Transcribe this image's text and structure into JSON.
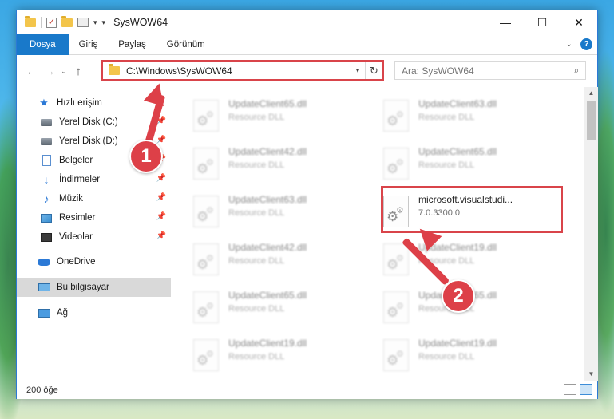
{
  "window": {
    "title": "SysWOW64",
    "controls": {
      "minimize": "—",
      "maximize": "☐",
      "close": "✕"
    }
  },
  "ribbon": {
    "tabs": [
      {
        "label": "Dosya",
        "active": true
      },
      {
        "label": "Giriş"
      },
      {
        "label": "Paylaş"
      },
      {
        "label": "Görünüm"
      }
    ],
    "help": "?"
  },
  "navigation": {
    "back": "←",
    "forward": "→",
    "recent": "⌄",
    "up": "↑",
    "address": "C:\\Windows\\SysWOW64",
    "search_placeholder": "Ara: SysWOW64"
  },
  "sidebar": {
    "items": [
      {
        "label": "Hızlı erişim",
        "icon": "star-icon"
      },
      {
        "label": "Yerel Disk (C:)",
        "icon": "drive-icon",
        "pinned": true
      },
      {
        "label": "Yerel Disk (D:)",
        "icon": "drive-icon",
        "pinned": true
      },
      {
        "label": "Belgeler",
        "icon": "documents-icon",
        "pinned": true
      },
      {
        "label": "İndirmeler",
        "icon": "downloads-icon",
        "pinned": true
      },
      {
        "label": "Müzik",
        "icon": "music-icon",
        "pinned": true
      },
      {
        "label": "Resimler",
        "icon": "pictures-icon",
        "pinned": true
      },
      {
        "label": "Videolar",
        "icon": "videos-icon",
        "pinned": true
      },
      {
        "label": "OneDrive",
        "icon": "onedrive-icon"
      },
      {
        "label": "Bu bilgisayar",
        "icon": "this-pc-icon",
        "selected": true
      },
      {
        "label": "Ağ",
        "icon": "network-icon"
      }
    ]
  },
  "files": {
    "left": [
      {
        "name": "UpdateClient65.dll",
        "type": "Resource DLL"
      },
      {
        "name": "UpdateClient42.dll",
        "type": "Resource DLL"
      },
      {
        "name": "UpdateClient63.dll",
        "type": "Resource DLL"
      },
      {
        "name": "UpdateClient42.dll",
        "type": "Resource DLL"
      },
      {
        "name": "UpdateClient65.dll",
        "type": "Resource DLL"
      },
      {
        "name": "UpdateClient19.dll",
        "type": "Resource DLL"
      }
    ],
    "right": [
      {
        "name": "UpdateClient63.dll",
        "type": "Resource DLL"
      },
      {
        "name": "UpdateClient65.dll",
        "type": "Resource DLL"
      },
      {
        "name": "microsoft.visualstudi...",
        "type": "7.0.3300.0",
        "highlighted": true
      },
      {
        "name": "UpdateClient19.dll",
        "type": "Resource DLL"
      },
      {
        "name": "UpdateClient65.dll",
        "type": "Resource DLL"
      },
      {
        "name": "UpdateClient19.dll",
        "type": "Resource DLL"
      }
    ]
  },
  "status": {
    "count": "200 öğe"
  },
  "annotations": {
    "callout1": "1",
    "callout2": "2",
    "color": "#dd4048"
  },
  "colors": {
    "accent": "#1979ca",
    "selection": "#d9d9d9"
  }
}
